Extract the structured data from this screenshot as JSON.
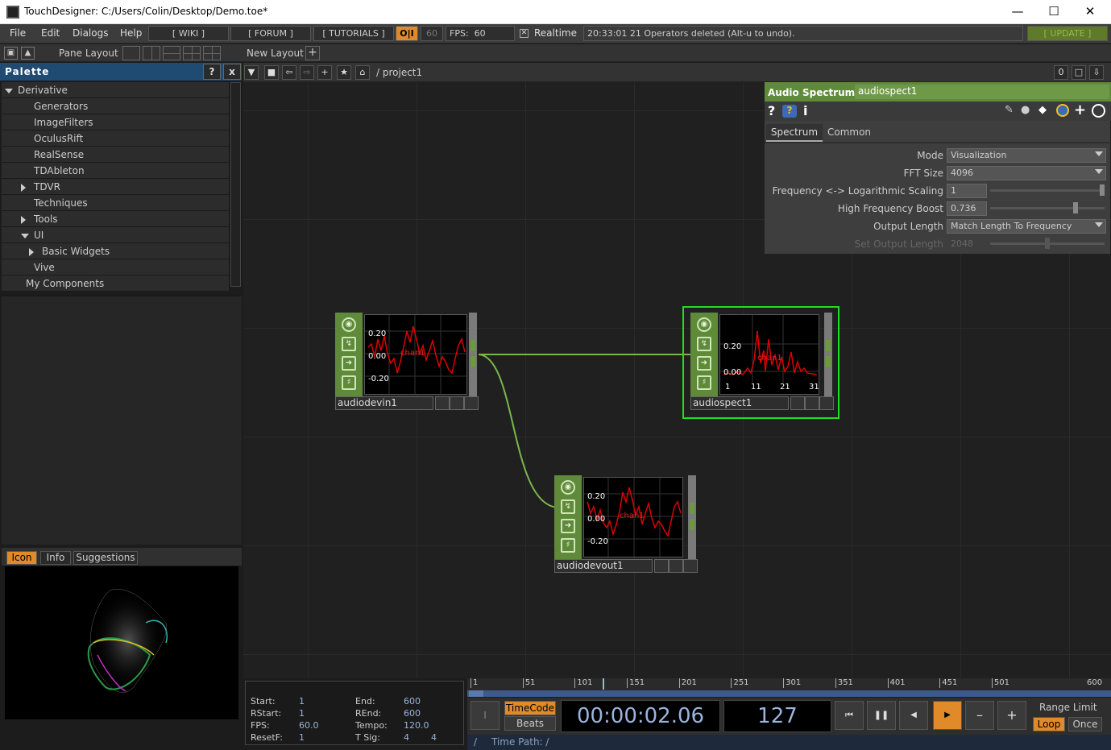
{
  "window": {
    "title": "TouchDesigner: C:/Users/Colin/Desktop/Demo.toe*"
  },
  "menubar": {
    "file": "File",
    "edit": "Edit",
    "dialogs": "Dialogs",
    "help": "Help",
    "wiki": "[ WIKI ]",
    "forum": "[ FORUM ]",
    "tutorials": "[ TUTORIALS ]",
    "oi": "O|I",
    "fps_cap": "60",
    "fps_label": "FPS:",
    "fps_value": "60",
    "realtime": "Realtime",
    "status": "20:33:01 21 Operators deleted (Alt-u to undo).",
    "update": "[ UPDATE ]"
  },
  "toolbar2": {
    "pane_layout": "Pane Layout",
    "new_layout": "New Layout"
  },
  "palette": {
    "title": "Palette",
    "help": "?",
    "close": "x",
    "items": [
      {
        "label": "Derivative",
        "expand": "open",
        "indent": 0
      },
      {
        "label": "Generators",
        "expand": "none",
        "indent": 2
      },
      {
        "label": "ImageFilters",
        "expand": "none",
        "indent": 2
      },
      {
        "label": "OculusRift",
        "expand": "none",
        "indent": 2
      },
      {
        "label": "RealSense",
        "expand": "none",
        "indent": 2
      },
      {
        "label": "TDAbleton",
        "expand": "none",
        "indent": 2
      },
      {
        "label": "TDVR",
        "expand": "closed",
        "indent": 2
      },
      {
        "label": "Techniques",
        "expand": "none",
        "indent": 2
      },
      {
        "label": "Tools",
        "expand": "closed",
        "indent": 2
      },
      {
        "label": "UI",
        "expand": "open",
        "indent": 2
      },
      {
        "label": "Basic Widgets",
        "expand": "closed",
        "indent": 3
      },
      {
        "label": "Vive",
        "expand": "none",
        "indent": 2
      },
      {
        "label": "My Components",
        "expand": "none",
        "indent": 1
      }
    ]
  },
  "bottom_tabs": {
    "icon": "Icon",
    "info": "Info",
    "suggestions": "Suggestions"
  },
  "network": {
    "path": "/ project1",
    "zero": "0"
  },
  "nodes": {
    "audiodevin": {
      "name": "audiodevin1",
      "top": "0.20",
      "mid": "0.00",
      "bot": "-0.20",
      "chan": "chan1"
    },
    "audiospect": {
      "name": "audiospect1",
      "top": "0.20",
      "mid": "0.00",
      "chan": "chan1",
      "x1": "1",
      "x2": "11",
      "x3": "21",
      "x4": "31"
    },
    "audiodevout": {
      "name": "audiodevout1",
      "top": "0.20",
      "mid": "0.00",
      "bot": "-0.20",
      "chan": "chan1"
    }
  },
  "params": {
    "type": "Audio Spectrum",
    "opname": "audiospect1",
    "tab1": "Spectrum",
    "tab2": "Common",
    "rows": [
      {
        "label": "Mode",
        "value": "Visualization",
        "kind": "menu"
      },
      {
        "label": "FFT Size",
        "value": "4096",
        "kind": "menu"
      },
      {
        "label": "Frequency <-> Logarithmic Scaling",
        "value": "1",
        "kind": "slider"
      },
      {
        "label": "High Frequency Boost",
        "value": "0.736",
        "kind": "slider"
      },
      {
        "label": "Output Length",
        "value": "Match Length To Frequency",
        "kind": "menu"
      },
      {
        "label": "Set Output Length",
        "value": "2048",
        "kind": "slider-disabled"
      }
    ]
  },
  "timeline": {
    "ticks": [
      "1",
      "51",
      "101",
      "151",
      "201",
      "251",
      "301",
      "351",
      "401",
      "451",
      "501",
      "600"
    ]
  },
  "info": {
    "start_l": "Start:",
    "start": "1",
    "end_l": "End:",
    "end": "600",
    "rstart_l": "RStart:",
    "rstart": "1",
    "rend_l": "REnd:",
    "rend": "600",
    "fps_l": "FPS:",
    "fps": "60.0",
    "tempo_l": "Tempo:",
    "tempo": "120.0",
    "resetf_l": "ResetF:",
    "resetf": "1",
    "tsig_l": "T Sig:",
    "tsig1": "4",
    "tsig2": "4"
  },
  "transport": {
    "timecode": "TimeCode",
    "beats": "Beats",
    "time": "00:00:02.06",
    "frame": "127",
    "range_limit": "Range Limit",
    "loop": "Loop",
    "once": "Once",
    "cursor": "I"
  },
  "timepath": {
    "slash": "/",
    "label": "Time Path: /"
  },
  "colors": {
    "accent": "#e08a2a",
    "op_green": "#5e8a3a",
    "selected": "#22dd22",
    "link": "#7ab84a"
  }
}
